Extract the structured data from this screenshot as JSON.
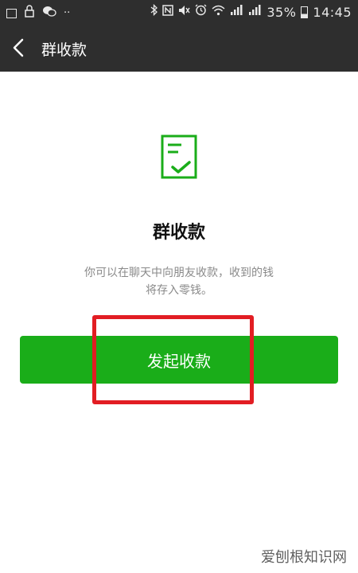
{
  "status_bar": {
    "battery": "35%",
    "time": "14:45",
    "left_icons": [
      "image-icon",
      "vpn-lock-icon",
      "wechat-icon",
      "more-dots-icon"
    ],
    "right_icons": [
      "bluetooth-icon",
      "nfc-icon",
      "mute-icon",
      "alarm-icon",
      "wifi-icon",
      "signal-icon",
      "signal-icon",
      "battery-icon"
    ]
  },
  "nav": {
    "back_icon": "chevron-left-icon",
    "title": "群收款"
  },
  "main": {
    "icon": "receipt-check-icon",
    "heading": "群收款",
    "desc_line1": "你可以在聊天中向朋友收款，收到的钱",
    "desc_line2": "将存入零钱。",
    "button_label": "发起收款"
  },
  "colors": {
    "nav_background": "#2e2e2e",
    "accent_green": "#1aad19",
    "highlight_red": "#e21d23",
    "description_gray": "#8a8a8a"
  },
  "watermark": "爱刨根知识网"
}
